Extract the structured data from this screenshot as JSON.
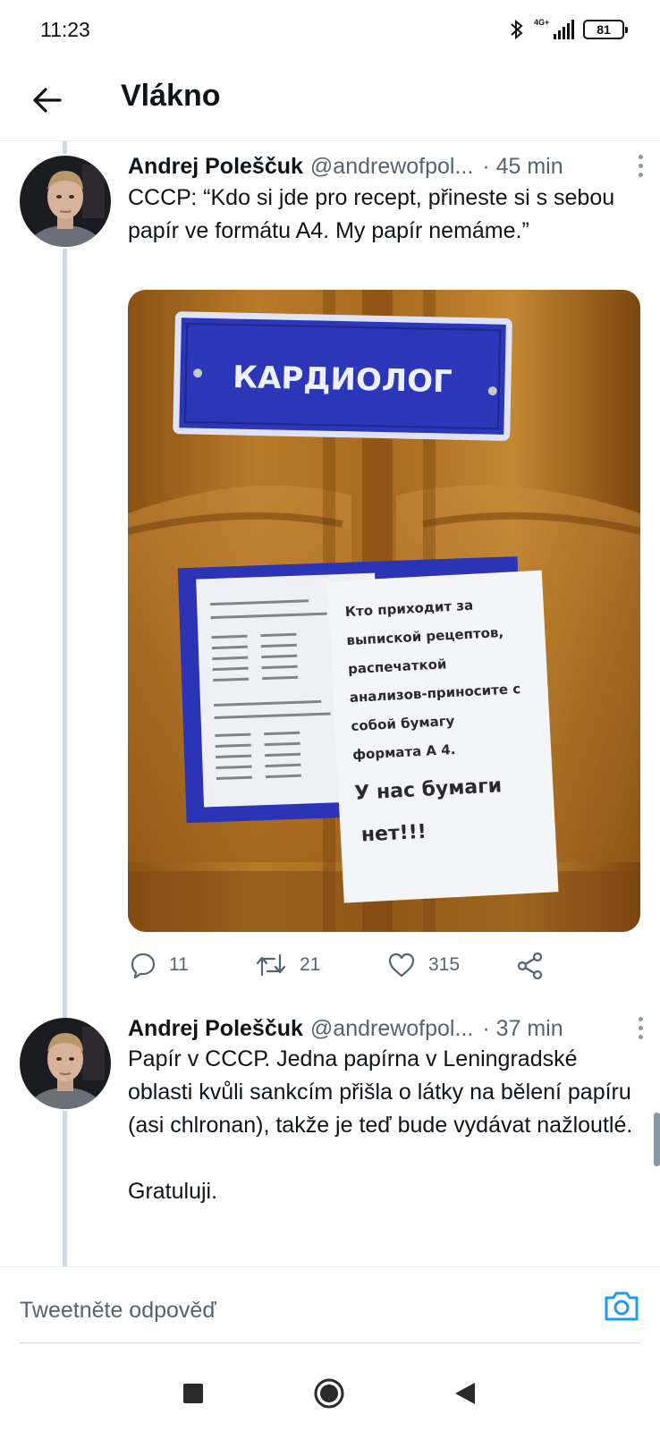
{
  "status_bar": {
    "time": "11:23",
    "network": "4G+",
    "battery": "81"
  },
  "header": {
    "title": "Vlákno",
    "back_icon": "arrow-left-icon"
  },
  "tweets": [
    {
      "author": "Andrej Polеščuk",
      "handle": "@andrewofpol...",
      "time": "· 45 min",
      "text": "СССР: “Kdo si jde pro recept, přineste si s sebou papír ve formátu A4. My papír nemáme.”",
      "image": {
        "sign_text": "КАРДИОЛОГ",
        "note_lines": [
          "Кто приходит за",
          "выпиской рецептов,",
          "распечаткой",
          "анализов-приносите с",
          "собой бумагу",
          "формата А 4.",
          "У нас бумаги",
          "нет!!!"
        ]
      },
      "stats": {
        "replies": "11",
        "retweets": "21",
        "likes": "315"
      }
    },
    {
      "author": "Andrej Polеščuk",
      "handle": "@andrewofpol...",
      "time": "· 37 min",
      "text": "Papír v СССР. Jedna papírna v Leningradské oblasti kvůli sankcím přišla o látky na bělení papíru (asi chlronan), takže je teď bude vydávat nažloutlé.\n\nGratuluji."
    }
  ],
  "reply": {
    "placeholder": "Tweetněte odpověď"
  },
  "colors": {
    "accent": "#1d9bf0",
    "text": "#0f1419",
    "secondary": "#536471",
    "thread_line": "#cfd9de",
    "sign_blue": "#2c36b8"
  }
}
